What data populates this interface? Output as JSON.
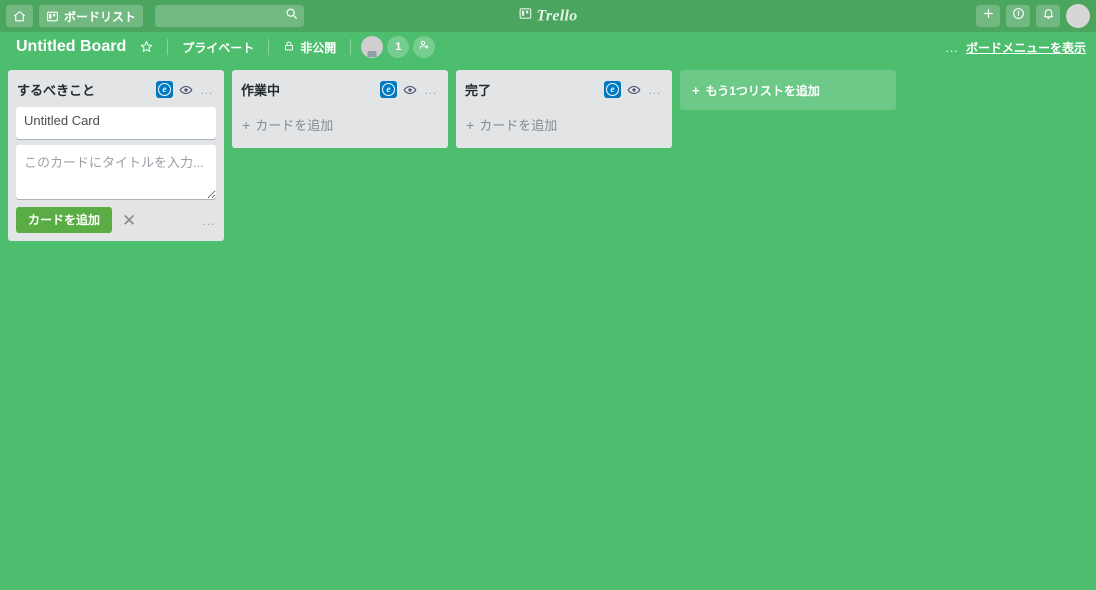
{
  "colors": {
    "board_background": "#4dbd6e",
    "top_bar": "#4aa55e",
    "list_background": "#e2e4e6",
    "card_background": "#ffffff",
    "add_card_button": "#5aac44",
    "list_badge": "#0079bf"
  },
  "top_bar": {
    "home_icon": "home-icon",
    "boards_button": {
      "icon": "board-icon",
      "label": "ボードリスト"
    },
    "search": {
      "value": "",
      "placeholder": "",
      "icon": "search-icon"
    },
    "logo": {
      "icon": "trello-board-icon",
      "text": "Trello"
    },
    "right_buttons": [
      {
        "name": "add-button",
        "icon": "plus-icon",
        "label": "+"
      },
      {
        "name": "info-button",
        "icon": "info-icon",
        "label": "i"
      },
      {
        "name": "notifications-button",
        "icon": "bell-icon",
        "label": "bell"
      }
    ],
    "avatar": "user-avatar"
  },
  "board_header": {
    "title": "Untitled Board",
    "star_icon": "star-icon",
    "visibility_team": "プライベート",
    "visibility_lock_icon": "lock-icon",
    "visibility_private": "非公開",
    "member_avatar": "member-avatar",
    "member_count": "1",
    "add_member_icon": "add-member-icon",
    "menu_dots": "…",
    "menu_label": "ボードメニューを表示"
  },
  "lists": [
    {
      "title": "するべきこと",
      "badge_icon": "subscribe-badge-icon",
      "badge_glyph": "e",
      "eye_icon": "eye-icon",
      "dots_icon": "list-menu-icon",
      "dots_glyph": "…",
      "cards": [
        {
          "title": "Untitled Card"
        }
      ],
      "composer": {
        "visible": true,
        "value": "",
        "placeholder": "このカードにタイトルを入力...",
        "add_button_label": "カードを追加",
        "close_icon": "close-icon",
        "close_glyph": "✕",
        "options_icon": "composer-options-icon",
        "options_glyph": "…"
      },
      "add_card_label": null
    },
    {
      "title": "作業中",
      "badge_icon": "subscribe-badge-icon",
      "badge_glyph": "e",
      "eye_icon": "eye-icon",
      "dots_icon": "list-menu-icon",
      "dots_glyph": "…",
      "cards": [],
      "composer": {
        "visible": false
      },
      "add_card_label": "カードを追加",
      "add_card_plus": "+"
    },
    {
      "title": "完了",
      "badge_icon": "subscribe-badge-icon",
      "badge_glyph": "e",
      "eye_icon": "eye-icon",
      "dots_icon": "list-menu-icon",
      "dots_glyph": "…",
      "cards": [],
      "composer": {
        "visible": false
      },
      "add_card_label": "カードを追加",
      "add_card_plus": "+"
    }
  ],
  "add_list": {
    "plus": "+",
    "label": "もう1つリストを追加"
  }
}
